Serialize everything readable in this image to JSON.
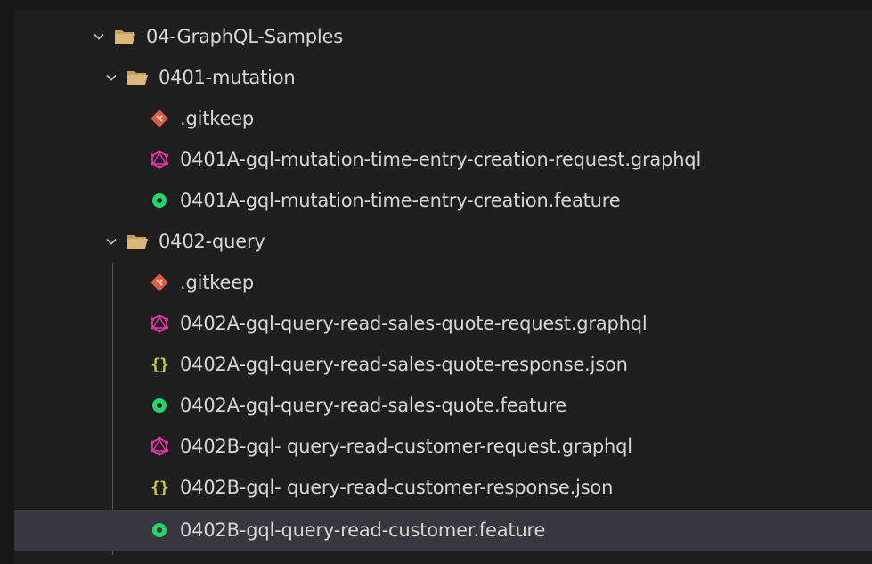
{
  "explorer": {
    "root_folder": {
      "name": "04-GraphQL-Samples",
      "expanded": true
    },
    "folders": [
      {
        "name": "0401-mutation",
        "expanded": true,
        "files": [
          {
            "name": ".gitkeep",
            "icon": "git-icon"
          },
          {
            "name": "0401A-gql-mutation-time-entry-creation-request.graphql",
            "icon": "graphql-icon"
          },
          {
            "name": "0401A-gql-mutation-time-entry-creation.feature",
            "icon": "cucumber-feature-icon"
          }
        ]
      },
      {
        "name": "0402-query",
        "expanded": true,
        "files": [
          {
            "name": ".gitkeep",
            "icon": "git-icon"
          },
          {
            "name": "0402A-gql-query-read-sales-quote-request.graphql",
            "icon": "graphql-icon"
          },
          {
            "name": "0402A-gql-query-read-sales-quote-response.json",
            "icon": "json-icon"
          },
          {
            "name": "0402A-gql-query-read-sales-quote.feature",
            "icon": "cucumber-feature-icon"
          },
          {
            "name": "0402B-gql- query-read-customer-request.graphql",
            "icon": "graphql-icon"
          },
          {
            "name": "0402B-gql- query-read-customer-response.json",
            "icon": "json-icon"
          },
          {
            "name": "0402B-gql-query-read-customer.feature",
            "icon": "cucumber-feature-icon"
          }
        ]
      }
    ],
    "selected_file": "0402B-gql-query-read-customer.feature",
    "colors": {
      "background": "#1f1f1f",
      "selection": "#37373d",
      "folder": "#dcb67a",
      "git": "#e05d44",
      "graphql": "#e535ab",
      "feature": "#23d96c",
      "json": "#cbcb41"
    }
  }
}
